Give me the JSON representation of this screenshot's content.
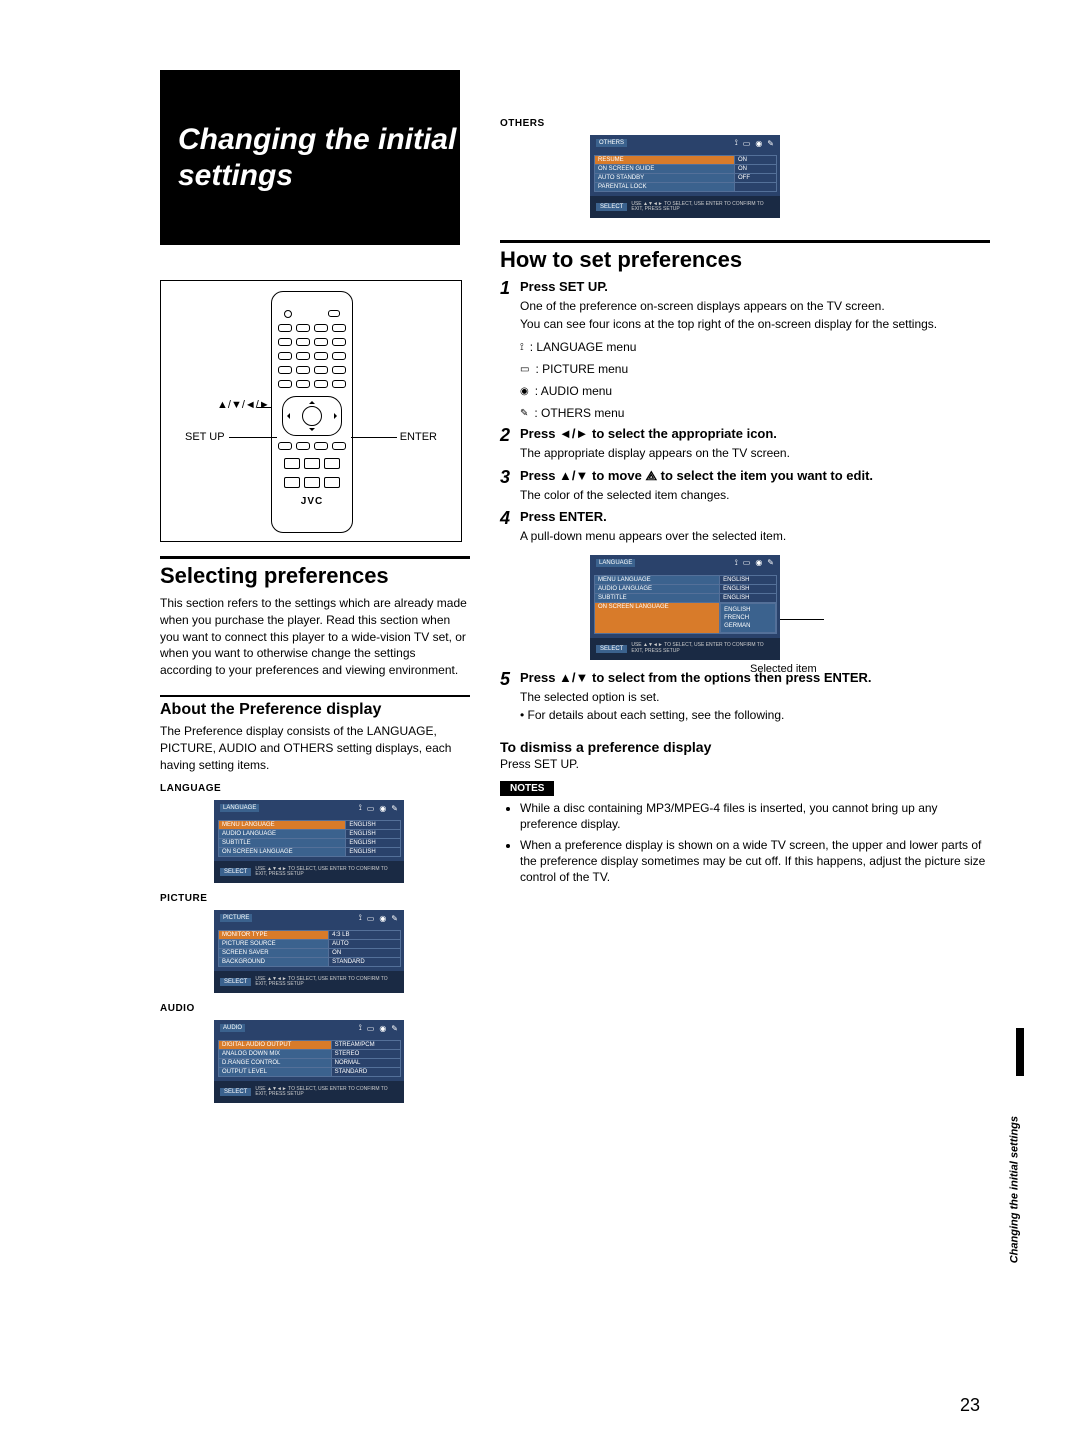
{
  "title_box": "Changing the initial settings",
  "remote": {
    "arrows_label": "▲/▼/◄/►",
    "setup_label": "SET UP",
    "enter_label": "ENTER",
    "brand": "JVC"
  },
  "left": {
    "selecting_h": "Selecting preferences",
    "selecting_p": "This section refers to the settings which are already made when you purchase the player. Read this section when you want to connect this player to a wide-vision TV set, or when you want to otherwise change the settings according to your preferences and viewing environment.",
    "about_h": "About the Preference display",
    "about_p": "The Preference display consists of the LANGUAGE, PICTURE, AUDIO and OTHERS setting displays, each having setting items.",
    "language_h": "LANGUAGE",
    "picture_h": "PICTURE",
    "audio_h": "AUDIO"
  },
  "right": {
    "others_h": "OTHERS",
    "howto_h": "How to set preferences",
    "step1_t": "Press SET UP.",
    "step1_d1": "One of the preference on-screen displays appears on the TV screen.",
    "step1_d2": "You can see four icons at the top right of the on-screen display for the settings.",
    "menu1": ": LANGUAGE menu",
    "menu2": ": PICTURE menu",
    "menu3": ": AUDIO menu",
    "menu4": ": OTHERS menu",
    "step2_t": "Press ◄/► to select the appropriate icon.",
    "step2_d": "The appropriate display appears on the TV screen.",
    "step3_t_a": "Press ▲/▼ to move ",
    "step3_t_b": " to select the item you want to edit.",
    "step3_d": "The color of the selected item changes.",
    "step4_t": "Press ENTER.",
    "step4_d": "A pull-down menu appears over the selected item.",
    "selected_item": "Selected item",
    "step5_t": "Press ▲/▼ to select from the options then press ENTER.",
    "step5_d1": "The selected option is set.",
    "step5_d2": "• For details about each setting, see the following.",
    "dismiss_h": "To dismiss a preference display",
    "dismiss_p": "Press SET UP.",
    "notes_h": "NOTES",
    "notes": [
      "While a disc containing MP3/MPEG-4 files is inserted, you cannot bring up any preference display.",
      "When a preference display is shown on a wide TV screen, the upper and lower parts of the preference display sometimes may be cut off. If this happens, adjust the picture size control of the TV."
    ]
  },
  "osd": {
    "select_btn": "SELECT",
    "hint": "USE ▲▼◄► TO SELECT, USE ENTER TO CONFIRM\nTO EXIT, PRESS SETUP",
    "language": {
      "tag": "LANGUAGE",
      "rows": [
        [
          "MENU LANGUAGE",
          "ENGLISH"
        ],
        [
          "AUDIO LANGUAGE",
          "ENGLISH"
        ],
        [
          "SUBTITLE",
          "ENGLISH"
        ],
        [
          "ON SCREEN LANGUAGE",
          "ENGLISH"
        ]
      ]
    },
    "picture": {
      "tag": "PICTURE",
      "rows": [
        [
          "MONITOR TYPE",
          "4:3 LB"
        ],
        [
          "PICTURE SOURCE",
          "AUTO"
        ],
        [
          "SCREEN SAVER",
          "ON"
        ],
        [
          "BACKGROUND",
          "STANDARD"
        ]
      ]
    },
    "audio": {
      "tag": "AUDIO",
      "rows": [
        [
          "DIGITAL AUDIO OUTPUT",
          "STREAM/PCM"
        ],
        [
          "ANALOG DOWN MIX",
          "STEREO"
        ],
        [
          "D.RANGE CONTROL",
          "NORMAL"
        ],
        [
          "OUTPUT LEVEL",
          "STANDARD"
        ]
      ]
    },
    "others": {
      "tag": "OTHERS",
      "rows": [
        [
          "RESUME",
          "ON"
        ],
        [
          "ON SCREEN GUIDE",
          "ON"
        ],
        [
          "AUTO STANDBY",
          "OFF"
        ],
        [
          "PARENTAL LOCK",
          ""
        ]
      ]
    },
    "dropdown": {
      "tag": "LANGUAGE",
      "rows": [
        [
          "MENU LANGUAGE",
          "ENGLISH"
        ],
        [
          "AUDIO LANGUAGE",
          "ENGLISH"
        ],
        [
          "SUBTITLE",
          "ENGLISH"
        ],
        [
          "ON SCREEN LANGUAGE",
          ""
        ]
      ],
      "options": [
        "ENGLISH",
        "FRENCH",
        "GERMAN"
      ]
    }
  },
  "footer": {
    "page": "23",
    "side": "Changing the initial settings"
  }
}
